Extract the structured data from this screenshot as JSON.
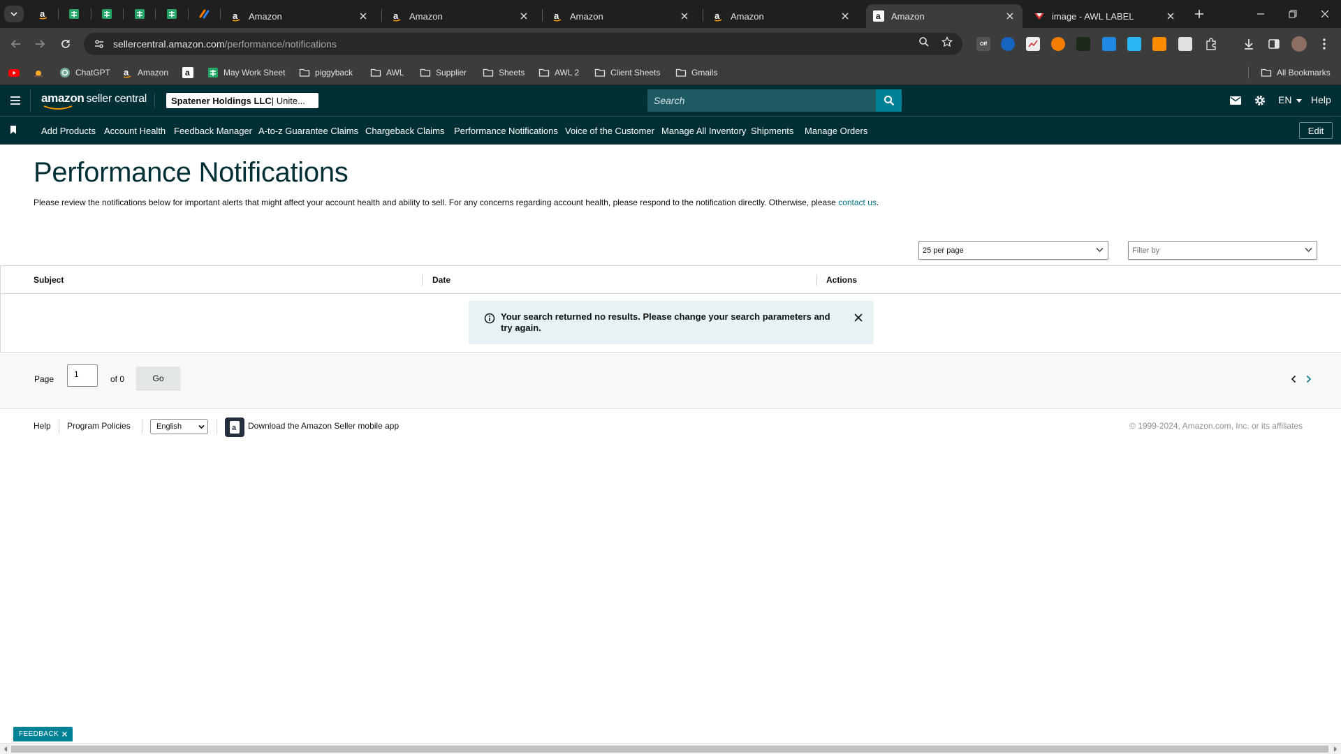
{
  "browser": {
    "tabs": [
      {
        "title": "Amazon"
      },
      {
        "title": "Amazon"
      },
      {
        "title": "Amazon"
      },
      {
        "title": "Amazon"
      },
      {
        "title": "Amazon"
      },
      {
        "title": "image - AWL LABEL"
      }
    ],
    "url_host": "sellercentral.amazon.com",
    "url_path": "/performance/notifications",
    "bookmarks": [
      {
        "label": "ChatGPT"
      },
      {
        "label": "Amazon"
      },
      {
        "label": "May Work Sheet"
      },
      {
        "label": "piggyback"
      },
      {
        "label": "AWL"
      },
      {
        "label": "Supplier"
      },
      {
        "label": "Sheets"
      },
      {
        "label": "AWL 2"
      },
      {
        "label": "Client Sheets"
      },
      {
        "label": "Gmails"
      }
    ],
    "all_bookmarks": "All Bookmarks",
    "extension_off_badge": "Off"
  },
  "header": {
    "logo_word1": "amazon",
    "logo_word2": "seller central",
    "account_bold": "Spatener Holdings LLC",
    "account_rest": " | Unite...",
    "search_placeholder": "Search",
    "language": "EN",
    "help": "Help"
  },
  "nav": {
    "links": [
      "Add Products",
      "Account Health",
      "Feedback Manager",
      "A-to-z Guarantee Claims",
      "Chargeback Claims",
      "Performance Notifications",
      "Voice of the Customer",
      "Manage All Inventory",
      "Shipments",
      "Manage Orders"
    ],
    "edit": "Edit"
  },
  "main": {
    "title": "Performance Notifications",
    "description": "Please review the notifications below for important alerts that might affect your account health and ability to sell. For any concerns regarding account health, please respond to the notification directly. Otherwise, please",
    "contact_link": "contact us",
    "per_page": "25 per page",
    "filter_placeholder": "Filter by",
    "columns": [
      "Subject",
      "Date",
      "Actions"
    ],
    "no_results": "Your search returned no results. Please change your search parameters and try again."
  },
  "pager": {
    "page_label": "Page",
    "page_value": "1",
    "of_label": "of 0",
    "go": "Go"
  },
  "footer": {
    "help": "Help",
    "program_policies": "Program Policies",
    "language": "English",
    "app_promo": "Download the Amazon Seller mobile app",
    "copyright": "© 1999-2024, Amazon.com, Inc. or its affiliates"
  },
  "feedback": {
    "label": "FEEDBACK"
  },
  "colors": {
    "header_bg": "#002f36",
    "accent_teal": "#008296",
    "link": "#007185",
    "alert_bg": "#e6f2f3"
  }
}
